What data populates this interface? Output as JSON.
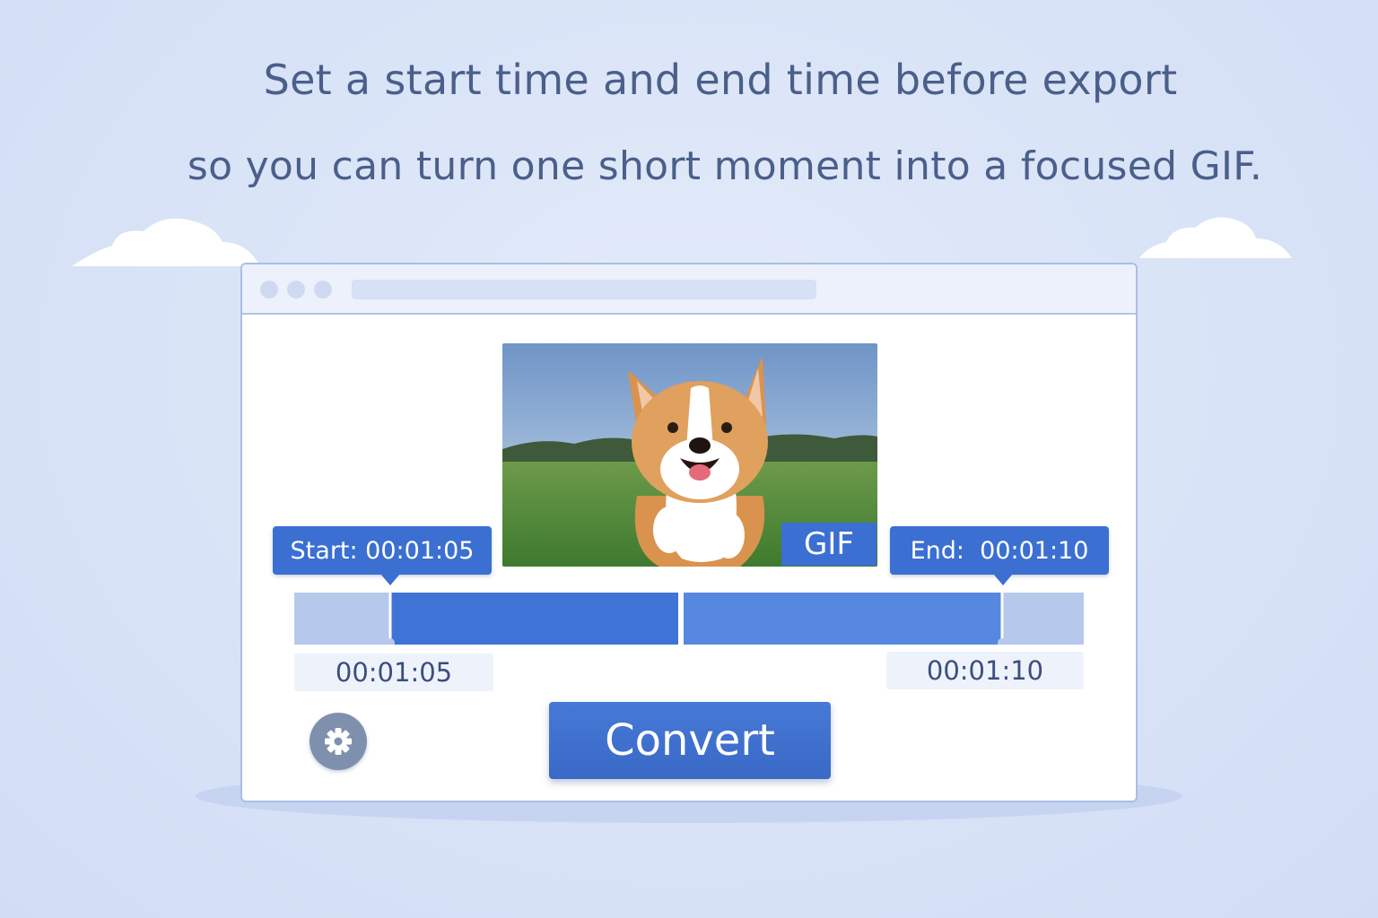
{
  "headline": {
    "line1": "Set a start time and end time before export",
    "line2": "so you can turn one short moment into a focused GIF."
  },
  "app": {
    "preview": {
      "badge": "GIF"
    },
    "start_tag": "Start: 00:01:05",
    "end_tag": "End:  00:01:10",
    "start_time": "00:01:05",
    "end_time": "00:01:10",
    "convert_label": "Convert",
    "settings_icon": "gear-icon"
  },
  "colors": {
    "accent": "#3b6fd2",
    "background": "#dbe5f8",
    "text": "#4a5f8a"
  }
}
